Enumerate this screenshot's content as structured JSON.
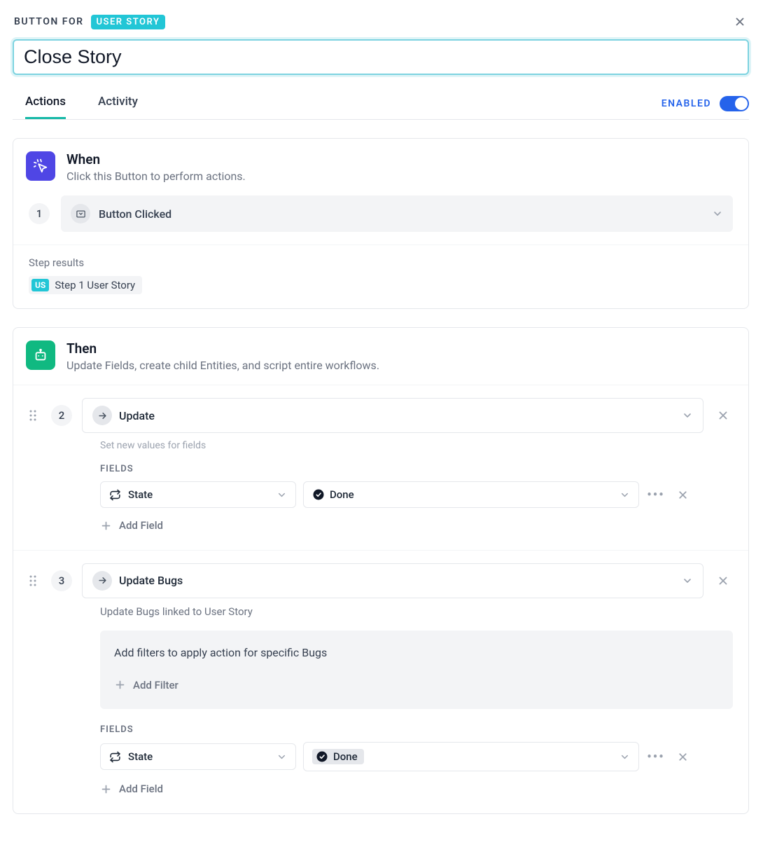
{
  "header": {
    "prefix": "BUTTON FOR",
    "badge": "USER STORY"
  },
  "title": "Close Story",
  "tabs": {
    "actions": "Actions",
    "activity": "Activity"
  },
  "enabled_label": "ENABLED",
  "when": {
    "title": "When",
    "subtitle": "Click this Button to perform actions.",
    "step_number": "1",
    "trigger": "Button Clicked",
    "results_label": "Step results",
    "result_chip_badge": "US",
    "result_chip_text": "Step 1 User Story"
  },
  "then": {
    "title": "Then",
    "subtitle": "Update Fields, create child Entities, and script entire workflows."
  },
  "actions": [
    {
      "number": "2",
      "name": "Update",
      "helper": "Set new values for fields",
      "fields_label": "FIELDS",
      "field_name": "State",
      "field_value": "Done",
      "value_highlighted": false,
      "add_field": "Add Field",
      "filter_prompt": null,
      "add_filter": null
    },
    {
      "number": "3",
      "name": "Update Bugs",
      "helper": "Update Bugs linked to User Story",
      "filter_prompt": "Add filters to apply action for specific Bugs",
      "add_filter": "Add Filter",
      "fields_label": "FIELDS",
      "field_name": "State",
      "field_value": "Done",
      "value_highlighted": true,
      "add_field": "Add Field"
    }
  ]
}
